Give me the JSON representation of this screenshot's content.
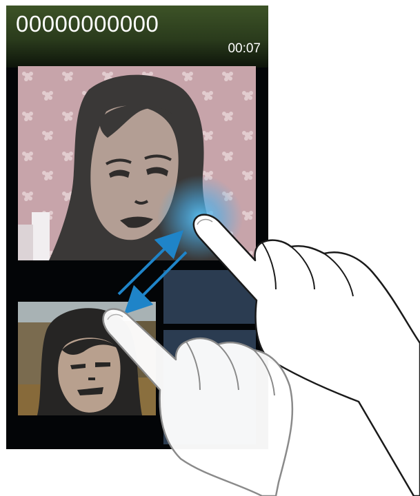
{
  "call": {
    "number": "00000000000",
    "duration": "00:07"
  },
  "icons": {
    "swap_gesture": "swap-arrows-icon"
  },
  "colors": {
    "header_top": "#3d5327",
    "header_bottom": "#0d140a",
    "screen_bg": "#030507",
    "panel": "#2b3c51",
    "arrow": "#1f84c8",
    "touch_glow": "#5bc2f5"
  }
}
